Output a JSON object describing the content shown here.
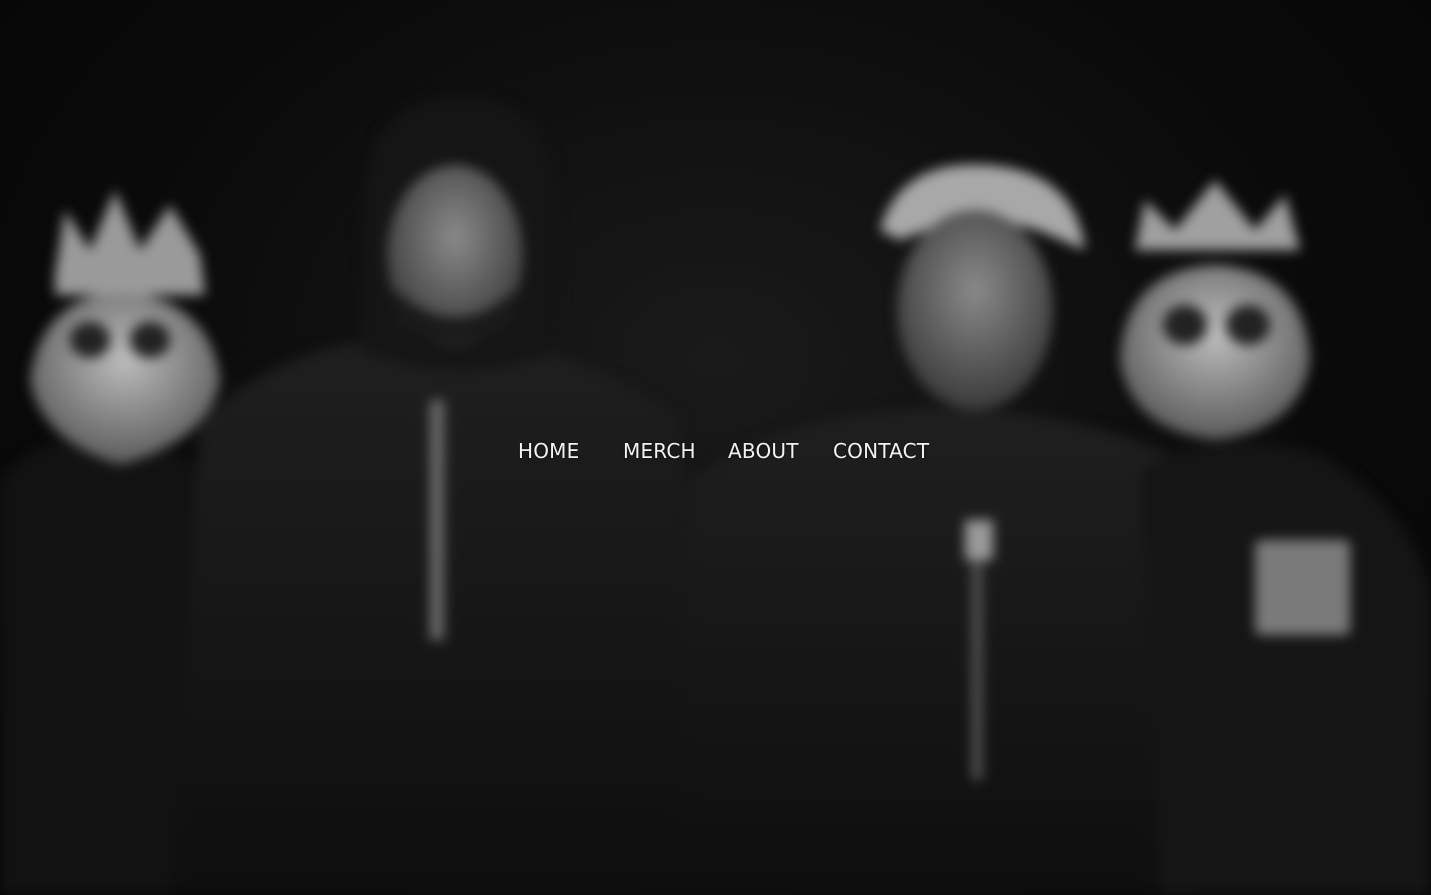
{
  "nav": {
    "items": [
      {
        "label": "HOME"
      },
      {
        "label": "MERCH"
      },
      {
        "label": "ABOUT"
      },
      {
        "label": "CONTACT"
      }
    ]
  },
  "hero": {
    "image": "band-photo-blurred-black-and-white",
    "colors": {
      "background": "#070707",
      "text": "#f2f2f2"
    }
  }
}
